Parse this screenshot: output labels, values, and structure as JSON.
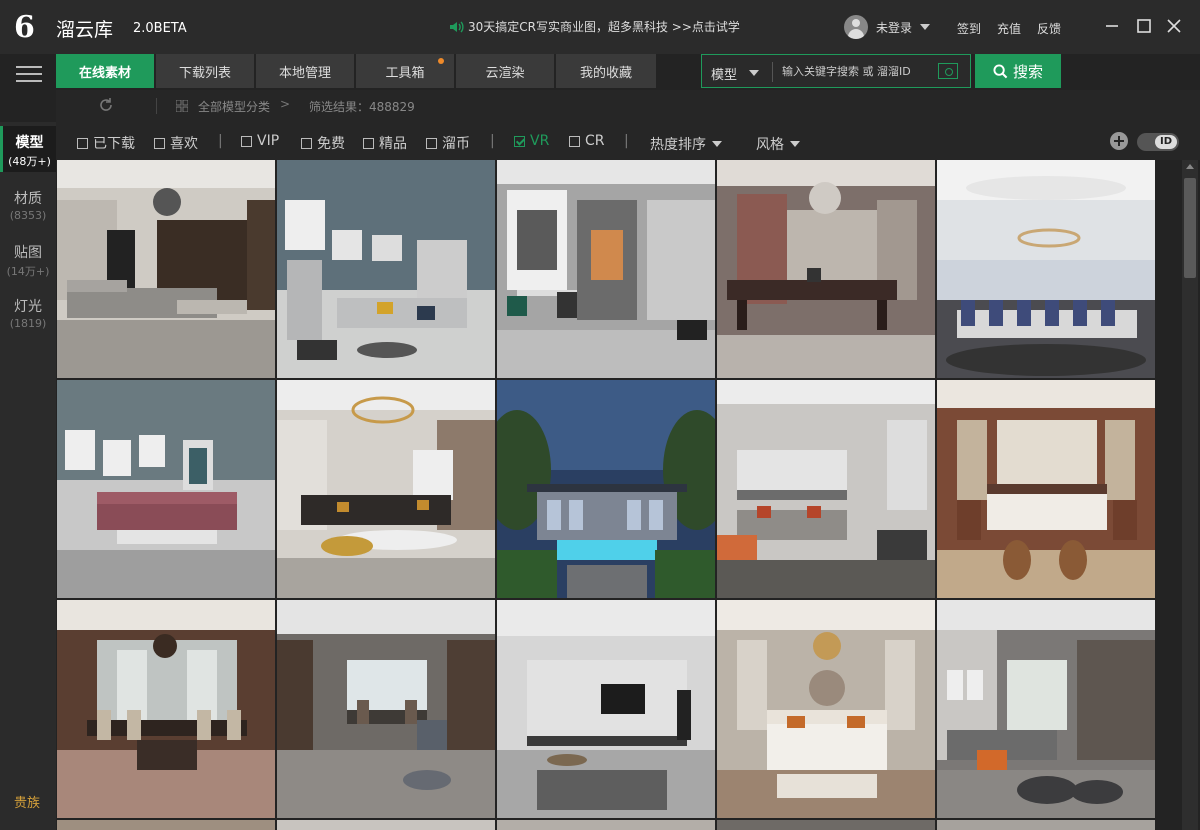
{
  "app": {
    "logo_glyph": "6",
    "name": "溜云库",
    "version": "2.0BETA"
  },
  "promo": "30天搞定CR写实商业图，超多黑科技 >>点击试学",
  "user": {
    "status": "未登录"
  },
  "top_links": {
    "signin": "签到",
    "recharge": "充值",
    "feedback": "反馈"
  },
  "tabs": [
    {
      "label": "在线素材",
      "active": true
    },
    {
      "label": "下载列表"
    },
    {
      "label": "本地管理"
    },
    {
      "label": "工具箱",
      "badge": true
    },
    {
      "label": "云渲染"
    },
    {
      "label": "我的收藏"
    }
  ],
  "search": {
    "type": "模型",
    "placeholder": "输入关键字搜索 或 溜溜ID",
    "button": "搜索"
  },
  "breadcrumb": {
    "all": "全部模型分类",
    "arrow": ">",
    "result": "筛选结果：488829"
  },
  "sidebar": [
    {
      "name": "模型",
      "count": "(48万+)",
      "active": true
    },
    {
      "name": "材质",
      "count": "(8353)"
    },
    {
      "name": "贴图",
      "count": "(14万+)"
    },
    {
      "name": "灯光",
      "count": "(1819)"
    }
  ],
  "vip": "贵族",
  "filters": {
    "downloaded": "已下载",
    "liked": "喜欢",
    "sep1": "|",
    "vip": "VIP",
    "free": "免费",
    "premium": "精品",
    "coin": "溜币",
    "sep2": "|",
    "vr": "VR",
    "cr": "CR",
    "sep3": "|",
    "sort": "热度排序",
    "style": "风格",
    "toggle": "ID"
  },
  "colors": {
    "accent": "#1f9a5b",
    "badge": "#ee8a2a",
    "vip": "#d4a03a"
  },
  "thumbnails": [
    {
      "scene": "living-room-marble"
    },
    {
      "scene": "living-room-blue-kaws"
    },
    {
      "scene": "dining-grey-minimal"
    },
    {
      "scene": "office-chandelier"
    },
    {
      "scene": "meeting-room-round"
    },
    {
      "scene": "living-room-blue-pink-sofa"
    },
    {
      "scene": "living-room-ring-lamp"
    },
    {
      "scene": "villa-exterior-pool"
    },
    {
      "scene": "kitchen-living-open"
    },
    {
      "scene": "bedroom-chinese"
    },
    {
      "scene": "dining-chinese"
    },
    {
      "scene": "dining-lounge-modern"
    },
    {
      "scene": "living-room-tv-wall"
    },
    {
      "scene": "bedroom-luxury-round"
    },
    {
      "scene": "living-room-grey-orange"
    }
  ]
}
